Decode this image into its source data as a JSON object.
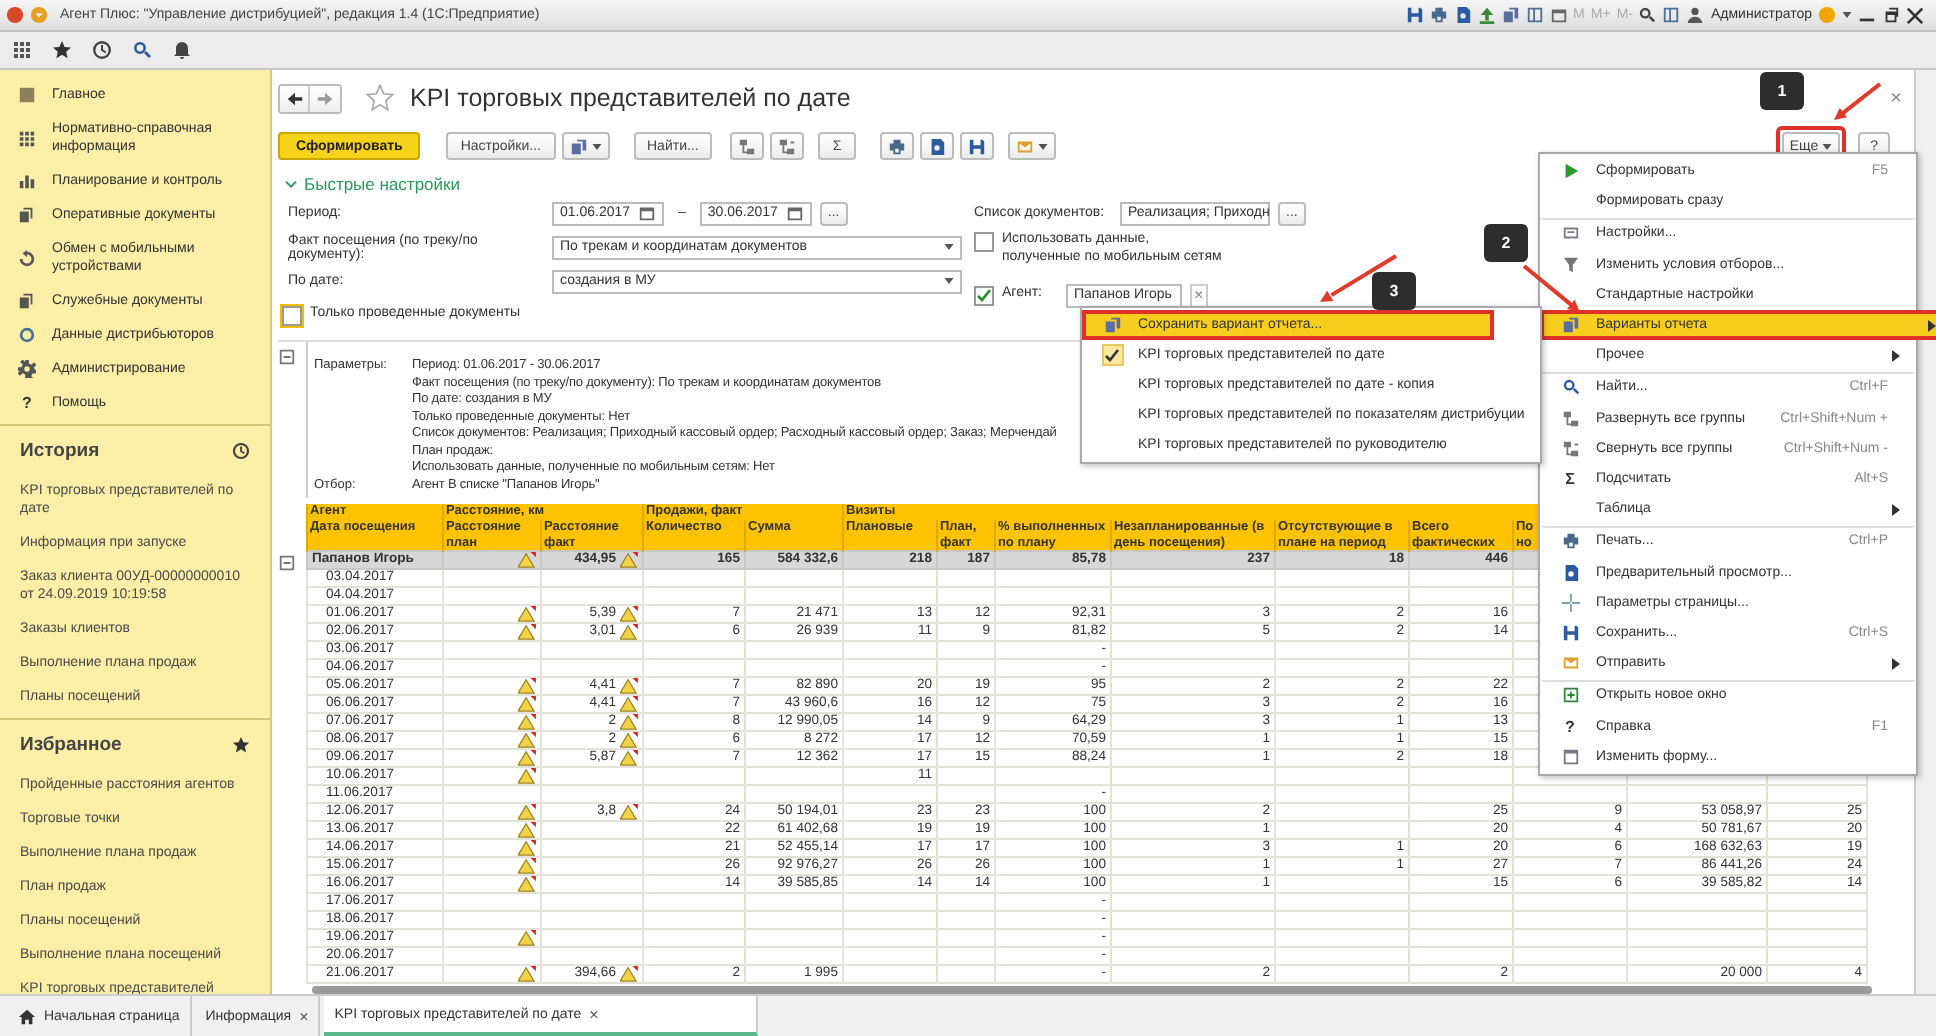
{
  "window": {
    "title": "Агент Плюс: \"Управление дистрибуцией\", редакция 1.4  (1С:Предприятие)",
    "memory": [
      "M",
      "M+",
      "M-"
    ],
    "user": "Администратор"
  },
  "sidebar": {
    "sections": [
      {
        "label": "Главное"
      },
      {
        "label": "Нормативно-справочная информация"
      },
      {
        "label": "Планирование и контроль"
      },
      {
        "label": "Оперативные документы"
      },
      {
        "label": "Обмен с мобильными устройствами"
      },
      {
        "label": "Служебные документы"
      },
      {
        "label": "Данные дистрибьюторов"
      },
      {
        "label": "Администрирование"
      },
      {
        "label": "Помощь",
        "icon_text": "?"
      }
    ],
    "history": {
      "title": "История",
      "items": [
        "KPI торговых представителей по дате",
        "Информация при запуске",
        "Заказ клиента 00УД-00000000010 от 24.09.2019 10:19:58",
        "Заказы клиентов",
        "Выполнение плана продаж",
        "Планы посещений"
      ]
    },
    "favorites": {
      "title": "Избранное",
      "items": [
        "Пройденные расстояния агентов",
        "Торговые точки",
        "Выполнение плана продаж",
        "План продаж",
        "Планы посещений",
        "Выполнение плана посещений",
        "KPI торговых представителей"
      ]
    }
  },
  "page": {
    "title": "KPI торговых представителей по дате",
    "close": "×",
    "toolbar": [
      {
        "kind": "primary",
        "text": "Сформировать"
      },
      {
        "kind": "text",
        "text": "Настройки..."
      },
      {
        "kind": "icon_dropdown"
      },
      {
        "kind": "text",
        "text": "Найти..."
      },
      {
        "kind": "icon"
      },
      {
        "kind": "icon"
      },
      {
        "kind": "text",
        "text": "Σ"
      },
      {
        "kind": "icon"
      },
      {
        "kind": "icon"
      },
      {
        "kind": "icon"
      },
      {
        "kind": "icon_dropdown"
      }
    ],
    "more": {
      "text": "Еще",
      "highlighted": true
    },
    "help": "?"
  },
  "quick_settings": {
    "title": "Быстрые настройки",
    "expanded": true,
    "period": {
      "label": "Период:",
      "from": "01.06.2017",
      "separator": "–",
      "to": "30.06.2017",
      "more": "..."
    },
    "fields": [
      {
        "label": "Факт посещения (по треку/по документу):",
        "value": "По трекам и координатам документов"
      },
      {
        "label": "По дате:",
        "value": "создания в МУ"
      }
    ],
    "posted_only": {
      "label": "Только проведенные документы",
      "checked": false
    },
    "doc_list": {
      "label": "Список документов:",
      "value": "Реализация; Приходн",
      "more": "..."
    },
    "mobile": {
      "label": "Использовать данные,\nполученные по мобильным сетям",
      "checked": false
    },
    "agent": {
      "label": "Агент:",
      "checked": true,
      "value": "Папанов Игорь",
      "clear": "×"
    }
  },
  "report": {
    "params": [
      {
        "label": "Параметры:",
        "lines": [
          "Период: 01.06.2017 - 30.06.2017",
          "Факт посещения (по треку/по документу): По трекам и координатам документов",
          "По дате: создания в МУ",
          "Только проведенные документы: Нет",
          "Список документов: Реализация; Приходный кассовый ордер; Расходный кассовый ордер; Заказ; Мерчендай",
          "План продаж:",
          "Использовать данные, полученные по мобильным сетям: Нет"
        ]
      },
      {
        "label": "Отбор:",
        "lines": [
          "Агент В списке \"Папанов Игорь\""
        ]
      }
    ]
  },
  "table": {
    "groups": [
      {
        "text": "Агент",
        "columns": [
          {
            "header": "Дата посещения"
          }
        ]
      },
      {
        "text": "Расстояние, км",
        "columns": [
          {
            "header": "Расстояние план"
          },
          {
            "header": "Расстояние факт"
          }
        ]
      },
      {
        "text": "Продажи, факт",
        "columns": [
          {
            "header": "Количество"
          },
          {
            "header": "Сумма"
          }
        ]
      },
      {
        "text": "Визиты",
        "columns": [
          {
            "header": "Плановые"
          },
          {
            "header": "План, факт"
          },
          {
            "header": "% выполненных по плану"
          },
          {
            "header": "Незапланированные (в день посещения)"
          },
          {
            "header": "Отсутствующие в плане на период"
          },
          {
            "header": "Всего фактических"
          },
          {
            "header": "По\nно"
          }
        ]
      }
    ],
    "total": {
      "label": "Папанов Игорь",
      "plan_warning": true,
      "fact_warning": true,
      "distance_fact": "434,95",
      "quantity": "165",
      "amount": "584 332,6",
      "visits_planned": "218",
      "visits_actual": "187",
      "percent": "85,78",
      "unplanned": "237",
      "absent": "18",
      "total_actual": "446"
    },
    "rows": [
      {
        "label": "03.04.2017",
        "plan_warning": false,
        "fact_warning": false
      },
      {
        "label": "04.04.2017",
        "plan_warning": false,
        "fact_warning": false
      },
      {
        "label": "01.06.2017",
        "plan_warning": true,
        "fact_warning": true,
        "distance_fact": "5,39",
        "quantity": "7",
        "amount": "21 471",
        "visits_planned": "13",
        "visits_actual": "12",
        "percent": "92,31",
        "unplanned": "3",
        "absent": "2",
        "total_actual": "16"
      },
      {
        "label": "02.06.2017",
        "plan_warning": true,
        "fact_warning": true,
        "distance_fact": "3,01",
        "quantity": "6",
        "amount": "26 939",
        "visits_planned": "11",
        "visits_actual": "9",
        "percent": "81,82",
        "unplanned": "5",
        "absent": "2",
        "total_actual": "14"
      },
      {
        "label": "03.06.2017",
        "plan_warning": false,
        "fact_warning": false,
        "percent": "-"
      },
      {
        "label": "04.06.2017",
        "plan_warning": false,
        "fact_warning": false,
        "percent": "-"
      },
      {
        "label": "05.06.2017",
        "plan_warning": true,
        "fact_warning": true,
        "distance_fact": "4,41",
        "quantity": "7",
        "amount": "82 890",
        "visits_planned": "20",
        "visits_actual": "19",
        "percent": "95",
        "unplanned": "2",
        "absent": "2",
        "total_actual": "22"
      },
      {
        "label": "06.06.2017",
        "plan_warning": true,
        "fact_warning": true,
        "distance_fact": "4,41",
        "quantity": "7",
        "amount": "43 960,6",
        "visits_planned": "16",
        "visits_actual": "12",
        "percent": "75",
        "unplanned": "3",
        "absent": "2",
        "total_actual": "16"
      },
      {
        "label": "07.06.2017",
        "plan_warning": true,
        "fact_warning": true,
        "distance_fact": "2",
        "quantity": "8",
        "amount": "12 990,05",
        "visits_planned": "14",
        "visits_actual": "9",
        "percent": "64,29",
        "unplanned": "3",
        "absent": "1",
        "total_actual": "13"
      },
      {
        "label": "08.06.2017",
        "plan_warning": true,
        "fact_warning": true,
        "distance_fact": "2",
        "quantity": "6",
        "amount": "8 272",
        "visits_planned": "17",
        "visits_actual": "12",
        "percent": "70,59",
        "unplanned": "1",
        "absent": "1",
        "total_actual": "15"
      },
      {
        "label": "09.06.2017",
        "plan_warning": true,
        "fact_warning": true,
        "distance_fact": "5,87",
        "quantity": "7",
        "amount": "12 362",
        "visits_planned": "17",
        "visits_actual": "15",
        "percent": "88,24",
        "unplanned": "1",
        "absent": "2",
        "total_actual": "18"
      },
      {
        "label": "10.06.2017",
        "plan_warning": true,
        "fact_warning": false,
        "visits_planned": "11"
      },
      {
        "label": "11.06.2017",
        "plan_warning": false,
        "fact_warning": false,
        "percent": "-"
      },
      {
        "label": "12.06.2017",
        "plan_warning": true,
        "fact_warning": true,
        "distance_fact": "3,8",
        "quantity": "24",
        "amount": "50 194,01",
        "visits_planned": "23",
        "visits_actual": "23",
        "percent": "100",
        "unplanned": "2",
        "total_actual": "25",
        "column_12": "9",
        "column_13": "53 058,97",
        "column_14": "25"
      },
      {
        "label": "13.06.2017",
        "plan_warning": true,
        "fact_warning": false,
        "quantity": "22",
        "amount": "61 402,68",
        "visits_planned": "19",
        "visits_actual": "19",
        "percent": "100",
        "unplanned": "1",
        "total_actual": "20",
        "column_12": "4",
        "column_13": "50 781,67",
        "column_14": "20"
      },
      {
        "label": "14.06.2017",
        "plan_warning": true,
        "fact_warning": false,
        "quantity": "21",
        "amount": "52 455,14",
        "visits_planned": "17",
        "visits_actual": "17",
        "percent": "100",
        "unplanned": "3",
        "absent": "1",
        "total_actual": "20",
        "column_12": "6",
        "column_13": "168 632,63",
        "column_14": "19"
      },
      {
        "label": "15.06.2017",
        "plan_warning": true,
        "fact_warning": false,
        "quantity": "26",
        "amount": "92 976,27",
        "visits_planned": "26",
        "visits_actual": "26",
        "percent": "100",
        "unplanned": "1",
        "absent": "1",
        "total_actual": "27",
        "column_12": "7",
        "column_13": "86 441,26",
        "column_14": "24"
      },
      {
        "label": "16.06.2017",
        "plan_warning": true,
        "fact_warning": false,
        "quantity": "14",
        "amount": "39 585,85",
        "visits_planned": "14",
        "visits_actual": "14",
        "percent": "100",
        "unplanned": "1",
        "total_actual": "15",
        "column_12": "6",
        "column_13": "39 585,82",
        "column_14": "14"
      },
      {
        "label": "17.06.2017",
        "plan_warning": false,
        "fact_warning": false,
        "percent": "-"
      },
      {
        "label": "18.06.2017",
        "plan_warning": false,
        "fact_warning": false,
        "percent": "-"
      },
      {
        "label": "19.06.2017",
        "plan_warning": true,
        "fact_warning": false,
        "percent": "-"
      },
      {
        "label": "20.06.2017",
        "plan_warning": false,
        "fact_warning": false,
        "percent": "-"
      },
      {
        "label": "21.06.2017",
        "plan_warning": true,
        "fact_warning": true,
        "distance_fact": "394,66",
        "quantity": "2",
        "amount": "1 995",
        "percent": "-",
        "unplanned": "2",
        "total_actual": "2",
        "column_13": "20 000",
        "column_14": "4"
      }
    ]
  },
  "menu": {
    "items": [
      {
        "label": "Сформировать",
        "shortcut": "F5",
        "separator_before": false,
        "submenu": false,
        "selected": false
      },
      {
        "label": "Формировать сразу",
        "separator_before": false,
        "submenu": false,
        "selected": false
      },
      {
        "label": "Настройки...",
        "separator_before": true,
        "submenu": false,
        "selected": false
      },
      {
        "label": "Изменить условия отборов...",
        "separator_before": false,
        "submenu": false,
        "selected": false
      },
      {
        "label": "Стандартные настройки",
        "separator_before": false,
        "submenu": false,
        "selected": false
      },
      {
        "label": "Варианты отчета",
        "separator_before": false,
        "submenu": true,
        "selected": true
      },
      {
        "label": "Прочее",
        "separator_before": false,
        "submenu": true,
        "selected": false
      },
      {
        "label": "Найти...",
        "shortcut": "Ctrl+F",
        "separator_before": true,
        "submenu": false,
        "selected": false
      },
      {
        "label": "Развернуть все группы",
        "shortcut": "Ctrl+Shift+Num +",
        "separator_before": false,
        "submenu": false,
        "selected": false
      },
      {
        "label": "Свернуть все группы",
        "shortcut": "Ctrl+Shift+Num -",
        "separator_before": false,
        "submenu": false,
        "selected": false
      },
      {
        "label": "Подсчитать",
        "shortcut": "Alt+S",
        "icon_text": "Σ",
        "separator_before": false,
        "submenu": false,
        "selected": false
      },
      {
        "label": "Таблица",
        "separator_before": false,
        "submenu": true,
        "selected": false
      },
      {
        "label": "Печать...",
        "shortcut": "Ctrl+P",
        "separator_before": true,
        "submenu": false,
        "selected": false
      },
      {
        "label": "Предварительный просмотр...",
        "separator_before": false,
        "submenu": false,
        "selected": false
      },
      {
        "label": "Параметры страницы...",
        "separator_before": false,
        "submenu": false,
        "selected": false
      },
      {
        "label": "Сохранить...",
        "shortcut": "Ctrl+S",
        "separator_before": false,
        "submenu": false,
        "selected": false
      },
      {
        "label": "Отправить",
        "separator_before": false,
        "submenu": true,
        "selected": false
      },
      {
        "label": "Открыть новое окно",
        "separator_before": true,
        "submenu": false,
        "selected": false
      },
      {
        "label": "Справка",
        "shortcut": "F1",
        "icon_text": "?",
        "separator_before": false,
        "submenu": false,
        "selected": false
      },
      {
        "label": "Изменить форму...",
        "separator_before": false,
        "submenu": false,
        "selected": false
      }
    ]
  },
  "submenu": {
    "items": [
      {
        "label": "Сохранить вариант отчета...",
        "selected": true,
        "checked": false
      },
      {
        "label": "KPI торговых представителей по дате",
        "selected": false,
        "checked": true
      },
      {
        "label": "KPI торговых представителей по дате - копия",
        "selected": false,
        "checked": false
      },
      {
        "label": "KPI торговых представителей по показателям дистрибуции",
        "selected": false,
        "checked": false
      },
      {
        "label": "KPI торговых представителей по руководителю",
        "selected": false,
        "checked": false
      }
    ]
  },
  "annotations": [
    {
      "label": "1"
    },
    {
      "label": "2"
    },
    {
      "label": "3"
    }
  ],
  "tabs": [
    {
      "label": "Начальная страница",
      "selected": false
    },
    {
      "label": "Информация",
      "close": "×",
      "selected": false
    },
    {
      "label": "KPI торговых представителей по дате",
      "close": "×",
      "selected": true
    }
  ]
}
